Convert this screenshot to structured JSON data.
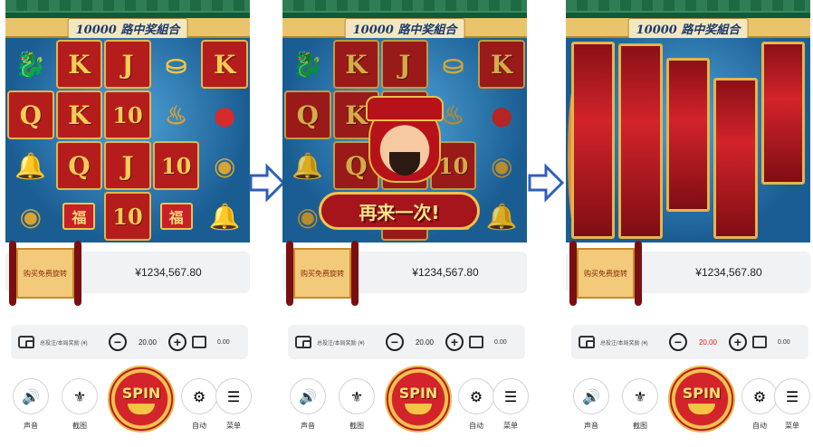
{
  "banner_title": "10000 路中奖組合",
  "again_text": "再来一次!",
  "scroll_text": "购买免费旋转",
  "balance": "¥1234,567.80",
  "bet_label": "总投注/本局奖励 (¥)",
  "bet_value": "20.00",
  "bet_value_panel3": "20.00",
  "win_value": "0.00",
  "spin_label": "SPIN",
  "controls": [
    "声音",
    "截图",
    "自动",
    "菜单"
  ],
  "reels_panel1": [
    [
      "dragon",
      "K",
      "J",
      "ingot",
      "K"
    ],
    [
      "Q",
      "K",
      "10",
      "pot",
      "lantern"
    ],
    [
      "bell",
      "Q",
      "J",
      "10",
      "coin"
    ],
    [
      "coin",
      "envelope",
      "10",
      "envelope",
      "bell"
    ]
  ],
  "colors": {
    "accent_red": "#c91f2a",
    "gold": "#f0c44e",
    "blue": "#1a5d93"
  }
}
